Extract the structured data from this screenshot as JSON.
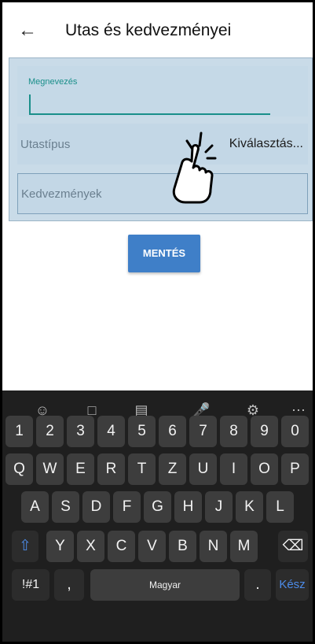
{
  "appbar": {
    "back_icon": "arrow-left-icon",
    "title": "Utas és kedvezményei"
  },
  "form": {
    "name_field": {
      "label": "Megnevezés",
      "value": ""
    },
    "passenger_type": {
      "label": "Utastípus",
      "value": "Kiválasztás..."
    },
    "discounts": {
      "label": "Kedvezmények"
    }
  },
  "save_button": {
    "label": "MENTÉS"
  },
  "keyboard": {
    "toolbar_icons": [
      "emoji-icon",
      "clipboard-icon",
      "sticker-icon",
      "mic-icon",
      "gear-icon",
      "more-icon"
    ],
    "number_row": [
      "1",
      "2",
      "3",
      "4",
      "5",
      "6",
      "7",
      "8",
      "9",
      "0"
    ],
    "row1": [
      "Q",
      "W",
      "E",
      "R",
      "T",
      "Z",
      "U",
      "I",
      "O",
      "P"
    ],
    "row2": [
      "A",
      "S",
      "D",
      "F",
      "G",
      "H",
      "J",
      "K",
      "L"
    ],
    "row3": [
      "Y",
      "X",
      "C",
      "V",
      "B",
      "N",
      "M"
    ],
    "symbols_key": "!#1",
    "comma_key": ",",
    "space_label": "Magyar",
    "period_key": ".",
    "done_key": "Kész",
    "colors": {
      "bg": "#1f1f1f",
      "key": "#3d3d3d",
      "accent": "#4c8be8"
    }
  }
}
